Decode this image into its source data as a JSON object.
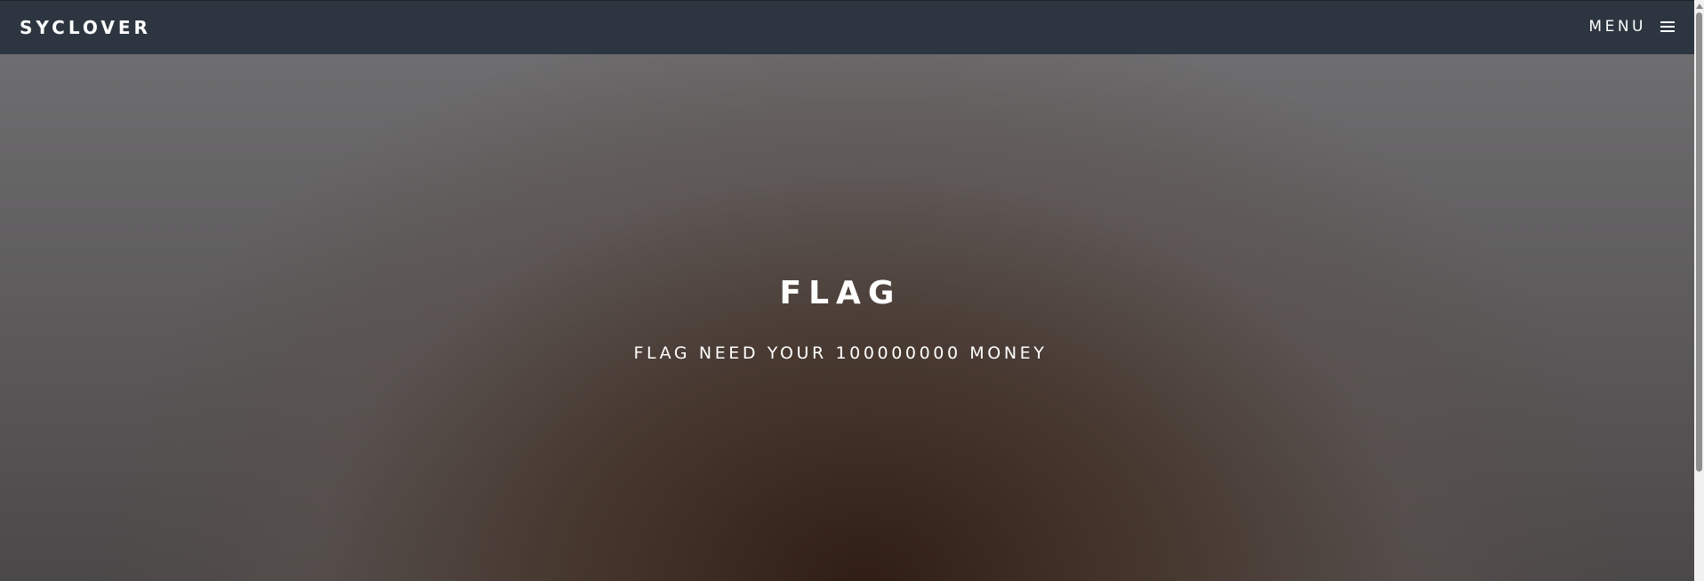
{
  "navbar": {
    "brand": "SYCLOVER",
    "menu_label": "MENU",
    "menu_icon": "hamburger-icon"
  },
  "hero": {
    "title": "FLAG",
    "subtitle": "FLAG NEED YOUR 100000000 MONEY"
  },
  "colors": {
    "navbar_bg": "#2d3640",
    "text": "#ffffff"
  }
}
